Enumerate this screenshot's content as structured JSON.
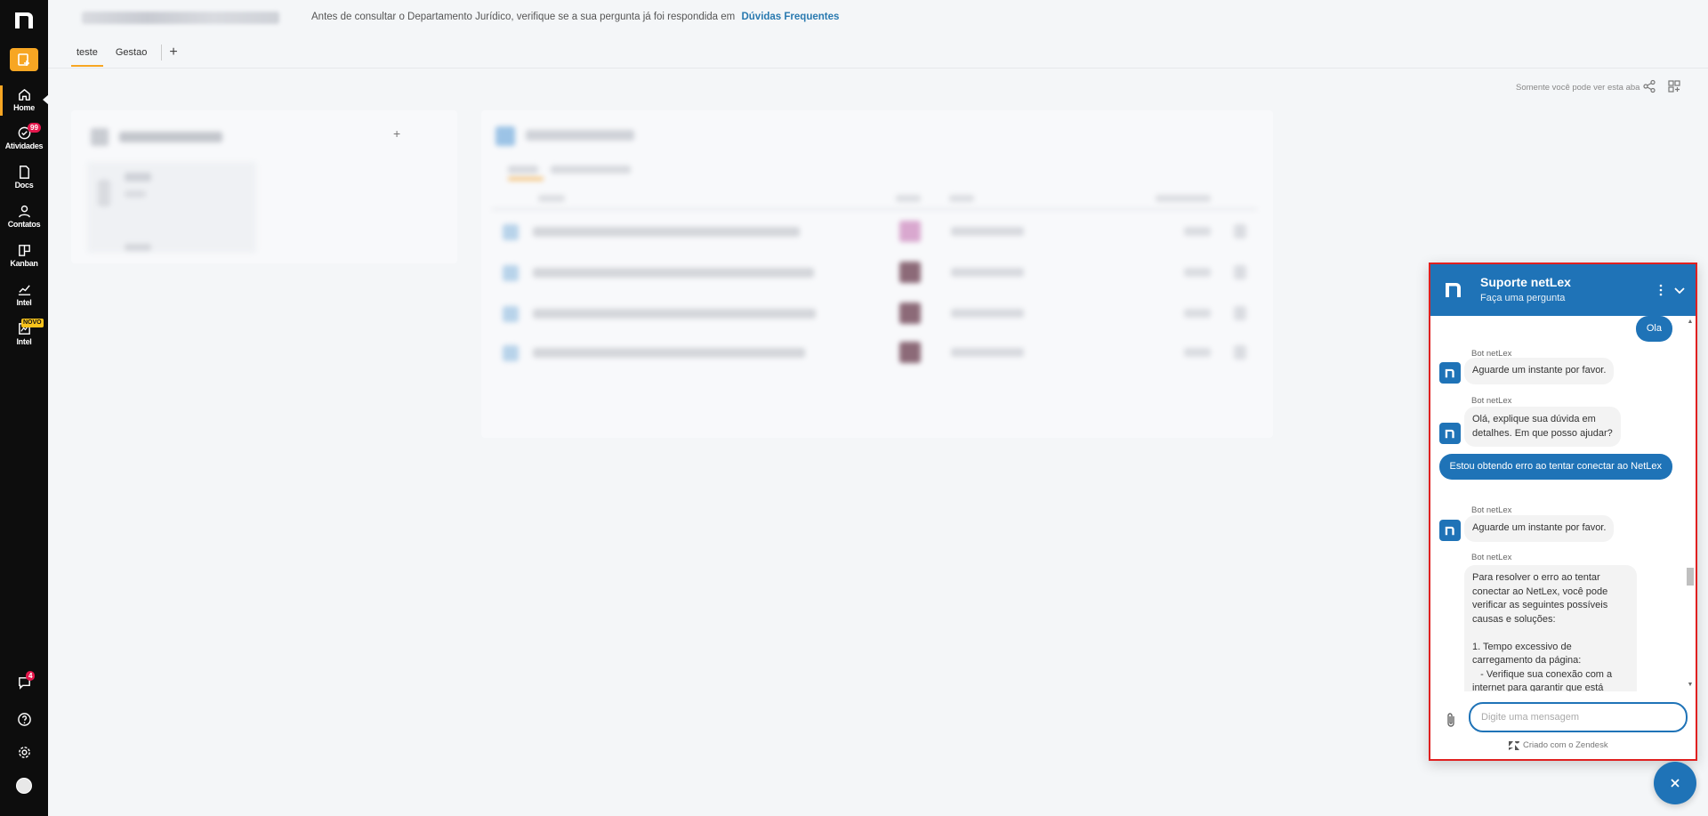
{
  "sidebar": {
    "items": [
      {
        "label": "Home",
        "icon": "home-icon"
      },
      {
        "label": "Atividades",
        "icon": "check-circle-icon",
        "badge": "99"
      },
      {
        "label": "Docs",
        "icon": "document-icon"
      },
      {
        "label": "Contatos",
        "icon": "person-icon"
      },
      {
        "label": "Kanban",
        "icon": "kanban-icon"
      },
      {
        "label": "Intel",
        "icon": "chart-icon"
      },
      {
        "label": "Intel",
        "icon": "chart-new-icon",
        "badge": "NOVO"
      }
    ],
    "messages_badge": "4"
  },
  "header": {
    "notice": "Antes de consultar o Departamento Jurídico, verifique se a sua pergunta já foi respondida em",
    "faq_link": "Dúvidas Frequentes"
  },
  "tabs": [
    {
      "label": "teste",
      "active": true
    },
    {
      "label": "Gestao",
      "active": false
    }
  ],
  "toolbar": {
    "visibility_note": "Somente você pode ver esta aba"
  },
  "chat": {
    "title": "Suporte netLex",
    "subtitle": "Faça uma pergunta",
    "bot_name": "Bot netLex",
    "messages": {
      "user1": "Ola",
      "bot1": "Aguarde um instante por favor.",
      "bot2": "Olá, explique sua dúvida em\ndetalhes. Em que posso ajudar?",
      "user2": "Estou obtendo erro ao tentar conectar\nao NetLex",
      "bot3": "Aguarde um instante por favor.",
      "bot4": "Para resolver o erro ao tentar\nconectar ao NetLex, você pode\nverificar as seguintes possíveis\ncausas e soluções:\n\n1. Tempo excessivo de\ncarregamento da página:\n   - Verifique sua conexão com a\ninternet para garantir que está"
    },
    "input_placeholder": "Digite uma mensagem",
    "powered_by": "Criado com o Zendesk"
  },
  "colors": {
    "accent": "#f7a623",
    "chat_brand": "#1f73b7",
    "sidebar_bg": "#0d0d0d",
    "highlight_border": "#e02020"
  }
}
